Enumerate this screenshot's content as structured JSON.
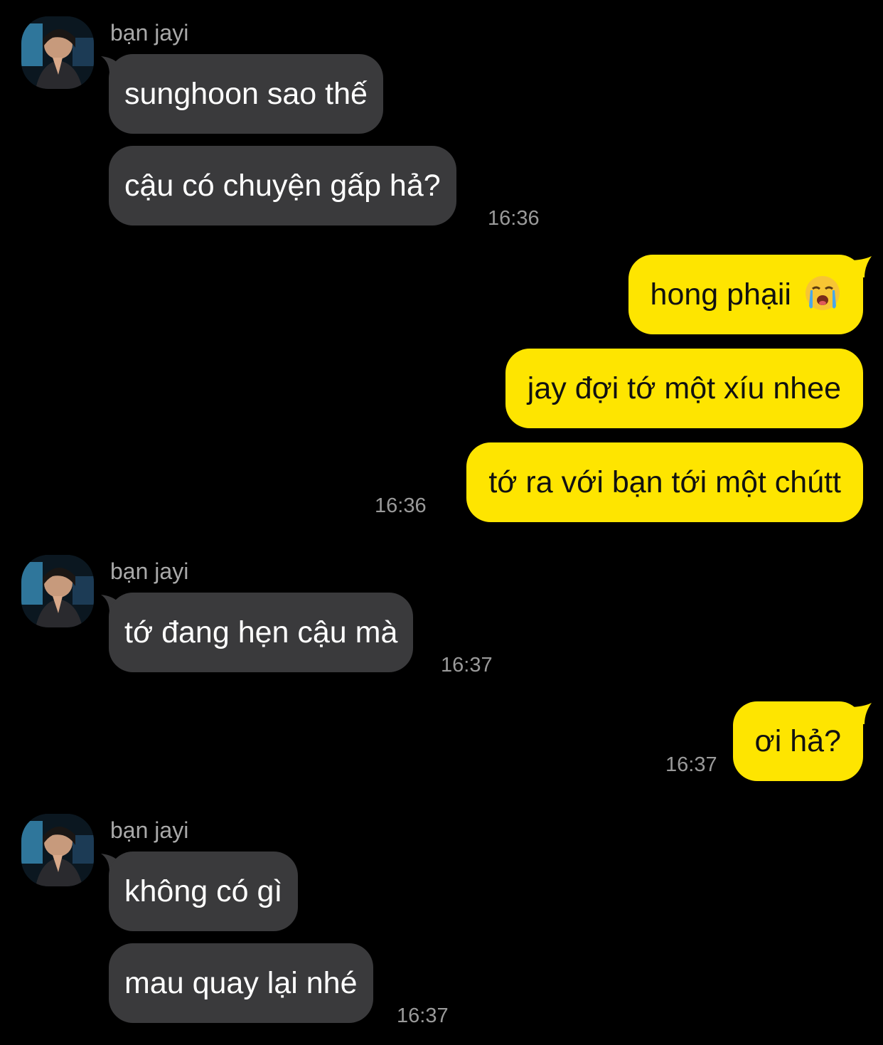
{
  "sender_name": "bạn jayi",
  "colors": {
    "background": "#000000",
    "incoming_bubble": "#3a3a3c",
    "outgoing_bubble": "#fee500",
    "timestamp": "#9a9a9a",
    "sender_name": "#a9a9a9"
  },
  "groups": [
    {
      "direction": "incoming",
      "sender": "bạn jayi",
      "messages": [
        "sunghoon sao thế",
        "cậu có chuyện gấp hả?"
      ],
      "time": "16:36"
    },
    {
      "direction": "outgoing",
      "messages": [
        "hong phạii",
        "jay đợi tớ một xíu nhee",
        "tớ ra với bạn tới một chútt"
      ],
      "emoji": "loudly-crying-face-icon",
      "time": "16:36"
    },
    {
      "direction": "incoming",
      "sender": "bạn jayi",
      "messages": [
        "tớ đang hẹn cậu mà"
      ],
      "time": "16:37"
    },
    {
      "direction": "outgoing",
      "messages": [
        "ơi hả?"
      ],
      "time": "16:37"
    },
    {
      "direction": "incoming",
      "sender": "bạn jayi",
      "messages": [
        "không có gì",
        "mau quay lại nhé"
      ],
      "time": "16:37"
    }
  ]
}
